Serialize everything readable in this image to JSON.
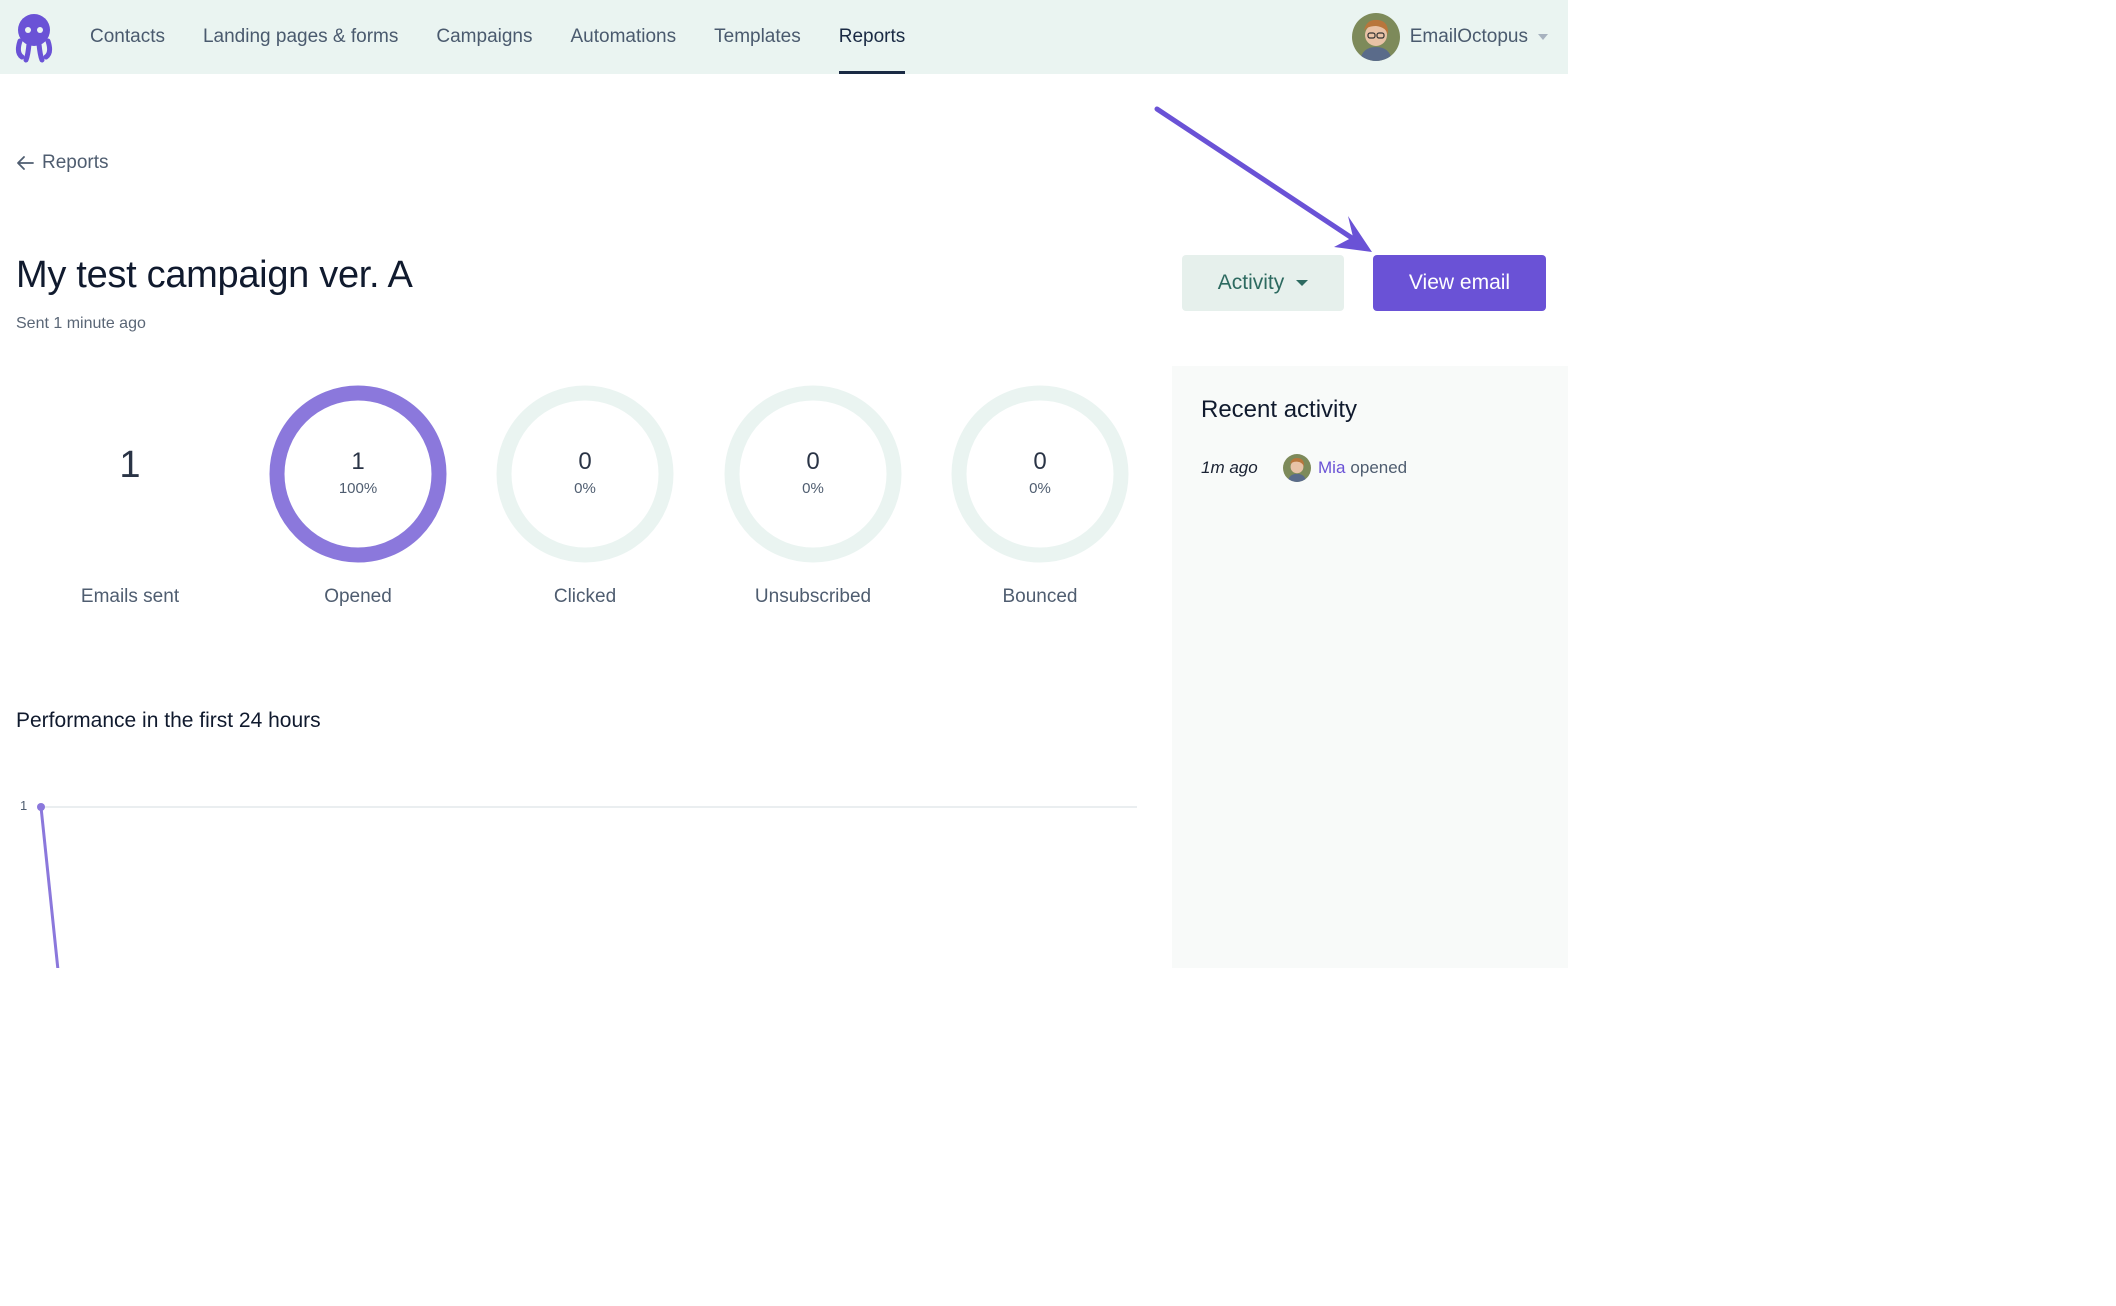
{
  "nav": {
    "items": [
      {
        "label": "Contacts"
      },
      {
        "label": "Landing pages & forms"
      },
      {
        "label": "Campaigns"
      },
      {
        "label": "Automations"
      },
      {
        "label": "Templates"
      },
      {
        "label": "Reports",
        "active": true
      }
    ],
    "account_name": "EmailOctopus"
  },
  "back_link": "Reports",
  "campaign": {
    "title": "My test campaign ver. A",
    "sent": "Sent 1 minute ago"
  },
  "actions": {
    "activity_label": "Activity",
    "view_email_label": "View email"
  },
  "stats": {
    "emails_sent": {
      "value": "1",
      "label": "Emails sent"
    },
    "opened": {
      "value": "1",
      "pct": "100%",
      "label": "Opened",
      "fraction": 1.0
    },
    "clicked": {
      "value": "0",
      "pct": "0%",
      "label": "Clicked",
      "fraction": 0
    },
    "unsubscribed": {
      "value": "0",
      "pct": "0%",
      "label": "Unsubscribed",
      "fraction": 0
    },
    "bounced": {
      "value": "0",
      "pct": "0%",
      "label": "Bounced",
      "fraction": 0
    }
  },
  "recent_activity": {
    "title": "Recent activity",
    "items": [
      {
        "time": "1m ago",
        "name": "Mia",
        "verb": "opened"
      }
    ]
  },
  "performance": {
    "title": "Performance in the first 24 hours",
    "y_tick": "1"
  },
  "colors": {
    "accent": "#6a52d6",
    "ring_fill": "#8b78dc",
    "ring_track": "#eaf4f1",
    "nav_bg": "#eaf4f1"
  }
}
